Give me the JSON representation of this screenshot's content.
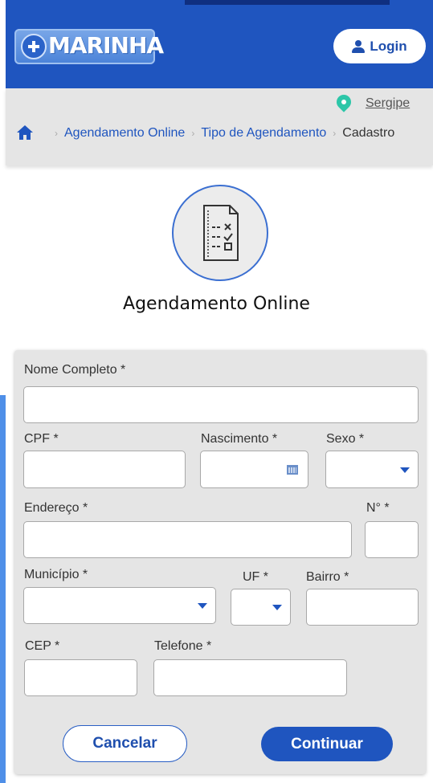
{
  "header": {
    "logo_text": "MARINHA",
    "login_label": "Login"
  },
  "location": {
    "label": "Sergipe"
  },
  "breadcrumb": {
    "items": [
      {
        "label": "Agendamento Online"
      },
      {
        "label": "Tipo de Agendamento"
      },
      {
        "label": "Cadastro"
      }
    ]
  },
  "page": {
    "title": "Agendamento Online"
  },
  "form": {
    "nome": {
      "label": "Nome Completo *",
      "value": ""
    },
    "cpf": {
      "label": "CPF *",
      "value": ""
    },
    "nascimento": {
      "label": "Nascimento *",
      "value": ""
    },
    "sexo": {
      "label": "Sexo *",
      "value": ""
    },
    "endereco": {
      "label": "Endereço *",
      "value": ""
    },
    "numero": {
      "label": "N° *",
      "value": ""
    },
    "municipio": {
      "label": "Município *",
      "value": ""
    },
    "uf": {
      "label": "UF *",
      "value": ""
    },
    "bairro": {
      "label": "Bairro *",
      "value": ""
    },
    "cep": {
      "label": "CEP *",
      "value": ""
    },
    "telefone": {
      "label": "Telefone *",
      "value": ""
    }
  },
  "actions": {
    "cancel_label": "Cancelar",
    "continue_label": "Continuar"
  },
  "colors": {
    "primary": "#1f55bf",
    "accent_pin": "#2cc6a8",
    "panel_bg": "#e5e5e5"
  }
}
